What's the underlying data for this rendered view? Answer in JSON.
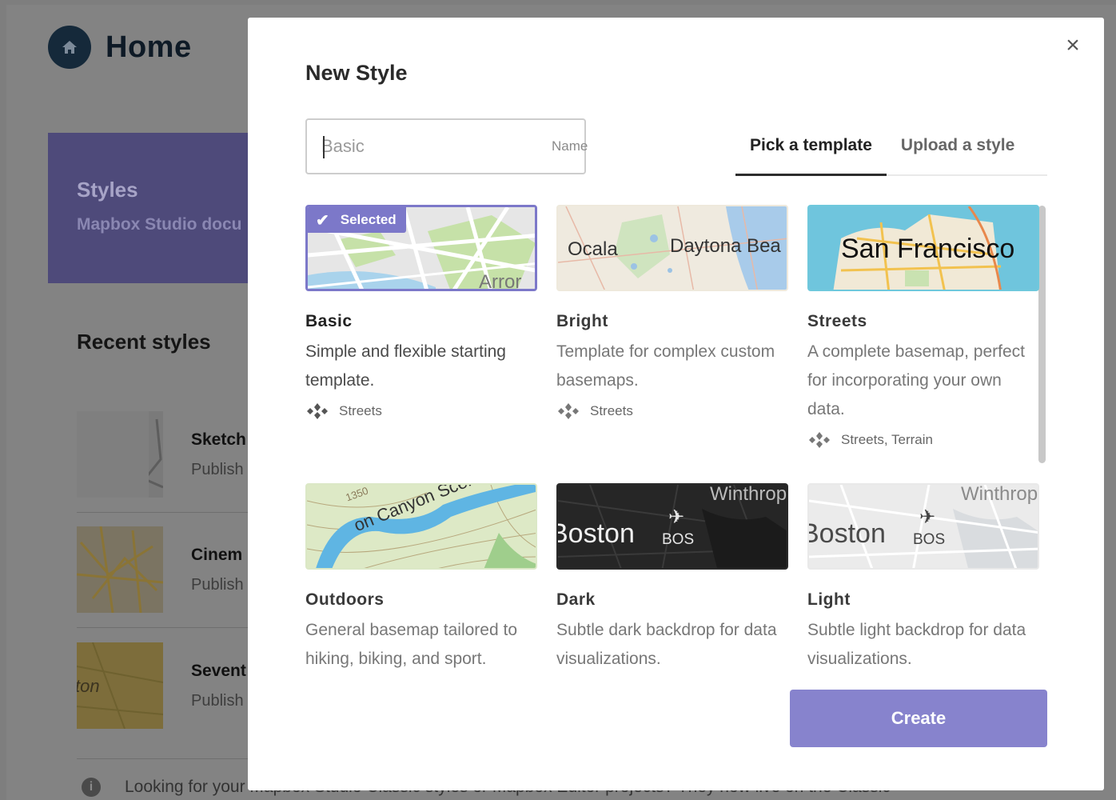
{
  "background": {
    "page_title": "Home",
    "banner": {
      "title": "Styles",
      "subtitle": "Mapbox Studio docu"
    },
    "recent": {
      "heading": "Recent styles",
      "items": [
        {
          "name": "Sketch",
          "status": "Publish"
        },
        {
          "name": "Cinem",
          "status": "Publish"
        },
        {
          "name": "Sevent",
          "status": "Publish",
          "thumb_label": "ton"
        }
      ]
    },
    "note": "Looking for your Mapbox Studio Classic styles or Mapbox Editor projects? They now live on the Classic"
  },
  "modal": {
    "title": "New Style",
    "close_label": "×",
    "name_field": {
      "placeholder": "Basic",
      "tag": "Name"
    },
    "tabs": [
      {
        "label": "Pick a template",
        "active": true
      },
      {
        "label": "Upload a style",
        "active": false
      }
    ],
    "selected_badge": "Selected",
    "templates": [
      {
        "title": "Basic",
        "desc": "Simple and flexible starting template.",
        "meta": "Streets",
        "selected": true,
        "map_labels": [
          "Arror"
        ]
      },
      {
        "title": "Bright",
        "desc": "Template for complex custom basemaps.",
        "meta": "Streets",
        "selected": false,
        "map_labels": [
          "Ocala",
          "Daytona Bea"
        ]
      },
      {
        "title": "Streets",
        "desc": "A complete basemap, perfect for incorporating your own data.",
        "meta": "Streets, Terrain",
        "selected": false,
        "map_labels": [
          "San Francisco"
        ]
      },
      {
        "title": "Outdoors",
        "desc": "General basemap tailored to hiking, biking, and sport.",
        "meta": "",
        "selected": false,
        "map_labels": [
          "on Canyon Scenic Dr",
          "1350"
        ]
      },
      {
        "title": "Dark",
        "desc": "Subtle dark backdrop for data visualizations.",
        "meta": "",
        "selected": false,
        "map_labels": [
          "Boston",
          "BOS",
          "Winthrop"
        ]
      },
      {
        "title": "Light",
        "desc": "Subtle light backdrop for data visualizations.",
        "meta": "",
        "selected": false,
        "map_labels": [
          "Boston",
          "BOS",
          "Winthrop"
        ]
      }
    ],
    "create_label": "Create"
  },
  "colors": {
    "accent": "#7c78c9",
    "button": "#8783cd",
    "overlay": "#838383"
  }
}
